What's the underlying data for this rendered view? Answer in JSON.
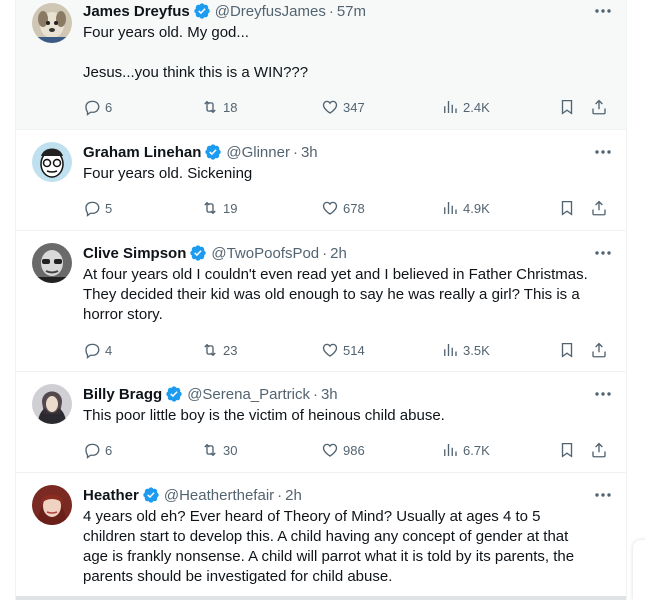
{
  "colors": {
    "text_primary": "#0f1419",
    "text_secondary": "#536471",
    "verified_blue": "#1d9bf0",
    "divider": "#eff3f4",
    "hover_bg": "#f7f9f9"
  },
  "icons": {
    "verified": "verified-badge-icon",
    "more": "more-dots-icon",
    "reply": "reply-bubble-icon",
    "retweet": "retweet-icon",
    "like": "heart-icon",
    "views": "views-bar-chart-icon",
    "bookmark": "bookmark-icon",
    "share": "share-upload-icon"
  },
  "tweets": [
    {
      "name": "James Dreyfus",
      "handle": "@DreyfusJames",
      "sep": "·",
      "time": "57m",
      "text": "Four years old. My god...\n\nJesus...you think this is a WIN???",
      "replies": "6",
      "retweets": "18",
      "likes": "347",
      "views": "2.4K"
    },
    {
      "name": "Graham Linehan",
      "handle": "@Glinner",
      "sep": "·",
      "time": "3h",
      "text": "Four years old. Sickening",
      "replies": "5",
      "retweets": "19",
      "likes": "678",
      "views": "4.9K"
    },
    {
      "name": "Clive Simpson",
      "handle": "@TwoPoofsPod",
      "sep": "·",
      "time": "2h",
      "text": "At four years old I couldn't even read yet and I believed in Father Christmas.\nThey decided their kid was old enough to say he was really a girl? This is a\nhorror story.",
      "replies": "4",
      "retweets": "23",
      "likes": "514",
      "views": "3.5K"
    },
    {
      "name": "Billy Bragg",
      "handle": "@Serena_Partrick",
      "sep": "·",
      "time": "3h",
      "text": "This poor little boy is the victim of heinous child abuse.",
      "replies": "6",
      "retweets": "30",
      "likes": "986",
      "views": "6.7K"
    },
    {
      "name": "Heather",
      "handle": "@Heatherthefair",
      "sep": "·",
      "time": "2h",
      "text": "4 years old eh? Ever heard of Theory of Mind? Usually at ages 4 to 5\nchildren start to develop this. A child having any concept of gender at that\nage is frankly nonsense. A child will parrot what it is told by its parents, the\nparents should be investigated for child abuse."
    }
  ]
}
